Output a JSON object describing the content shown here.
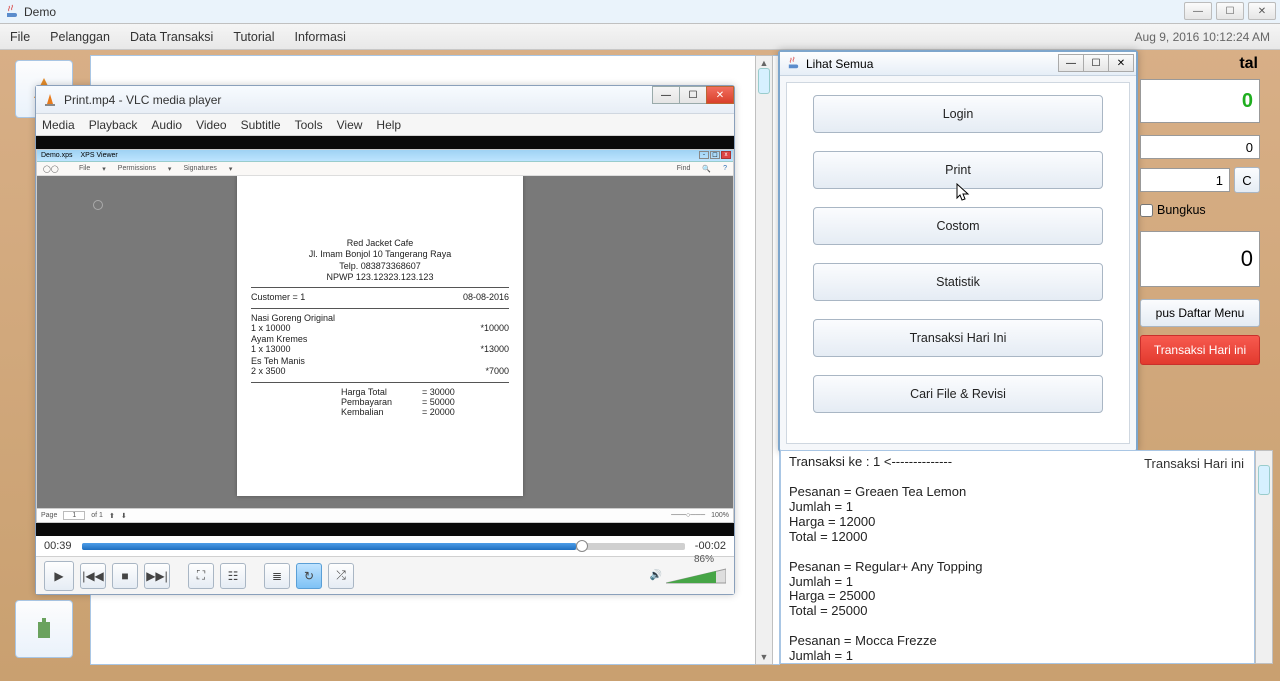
{
  "demo": {
    "title": "Demo"
  },
  "menubar": {
    "items": [
      "File",
      "Pelanggan",
      "Data Transaksi",
      "Tutorial",
      "Informasi"
    ],
    "clock": "Aug 9, 2016 10:12:24 AM"
  },
  "vlc": {
    "title": "Print.mp4 - VLC media player",
    "menu": [
      "Media",
      "Playback",
      "Audio",
      "Video",
      "Subtitle",
      "Tools",
      "View",
      "Help"
    ],
    "time_elapsed": "00:39",
    "time_remain": "-00:02",
    "volume_pct": "86%",
    "xps": {
      "titleApp": "Demo.xps",
      "titleViewer": "XPS Viewer",
      "tool_file": "File",
      "tool_perm": "Permissions",
      "tool_sig": "Signatures",
      "tool_find": "Find",
      "foot_page_lbl": "Page",
      "foot_page_cur": "1",
      "foot_page_of": "of 1",
      "foot_zoom": "100%"
    },
    "receipt": {
      "name": "Red Jacket Cafe",
      "addr": "Jl. Imam Bonjol 10 Tangerang Raya",
      "tel": "Telp. 083873368607",
      "npwp": "NPWP 123.12323.123.123",
      "cust": "Customer = 1",
      "date": "08-08-2016",
      "lines": [
        {
          "name": "Nasi Goreng Original",
          "qty": "1 x 10000",
          "amt": "*10000"
        },
        {
          "name": "Ayam Kremes",
          "qty": "1 x 13000",
          "amt": "*13000"
        },
        {
          "name": "Es Teh Manis",
          "qty": "2 x 3500",
          "amt": "*7000"
        }
      ],
      "tot_lbl": "Harga Total",
      "tot_val": "= 30000",
      "pay_lbl": "Pembayaran",
      "pay_val": "= 50000",
      "chg_lbl": "Kembalian",
      "chg_val": "= 20000"
    }
  },
  "ls": {
    "title": "Lihat Semua",
    "buttons": [
      "Login",
      "Print",
      "Costom",
      "Statistik",
      "Transaksi Hari Ini",
      "Cari File & Revisi"
    ]
  },
  "rp": {
    "total_lbl": "tal",
    "total_val": "0",
    "field1": "0",
    "field2": "1",
    "c_btn": "C",
    "bungkus": "Bungkus",
    "box": "0",
    "btn_clear": "pus Daftar Menu",
    "btn_red": "Transaksi Hari ini"
  },
  "tx": {
    "header_right": "Transaksi Hari ini",
    "lines": [
      "Transaksi ke : 1 <--------------",
      "",
      "Pesanan = Greaen Tea Lemon",
      "Jumlah  = 1",
      "Harga   = 12000",
      "Total   = 12000",
      "",
      "Pesanan = Regular+ Any Topping",
      "Jumlah  = 1",
      "Harga   = 25000",
      "Total   = 25000",
      "",
      "Pesanan = Mocca Frezze",
      "Jumlah  = 1"
    ]
  }
}
